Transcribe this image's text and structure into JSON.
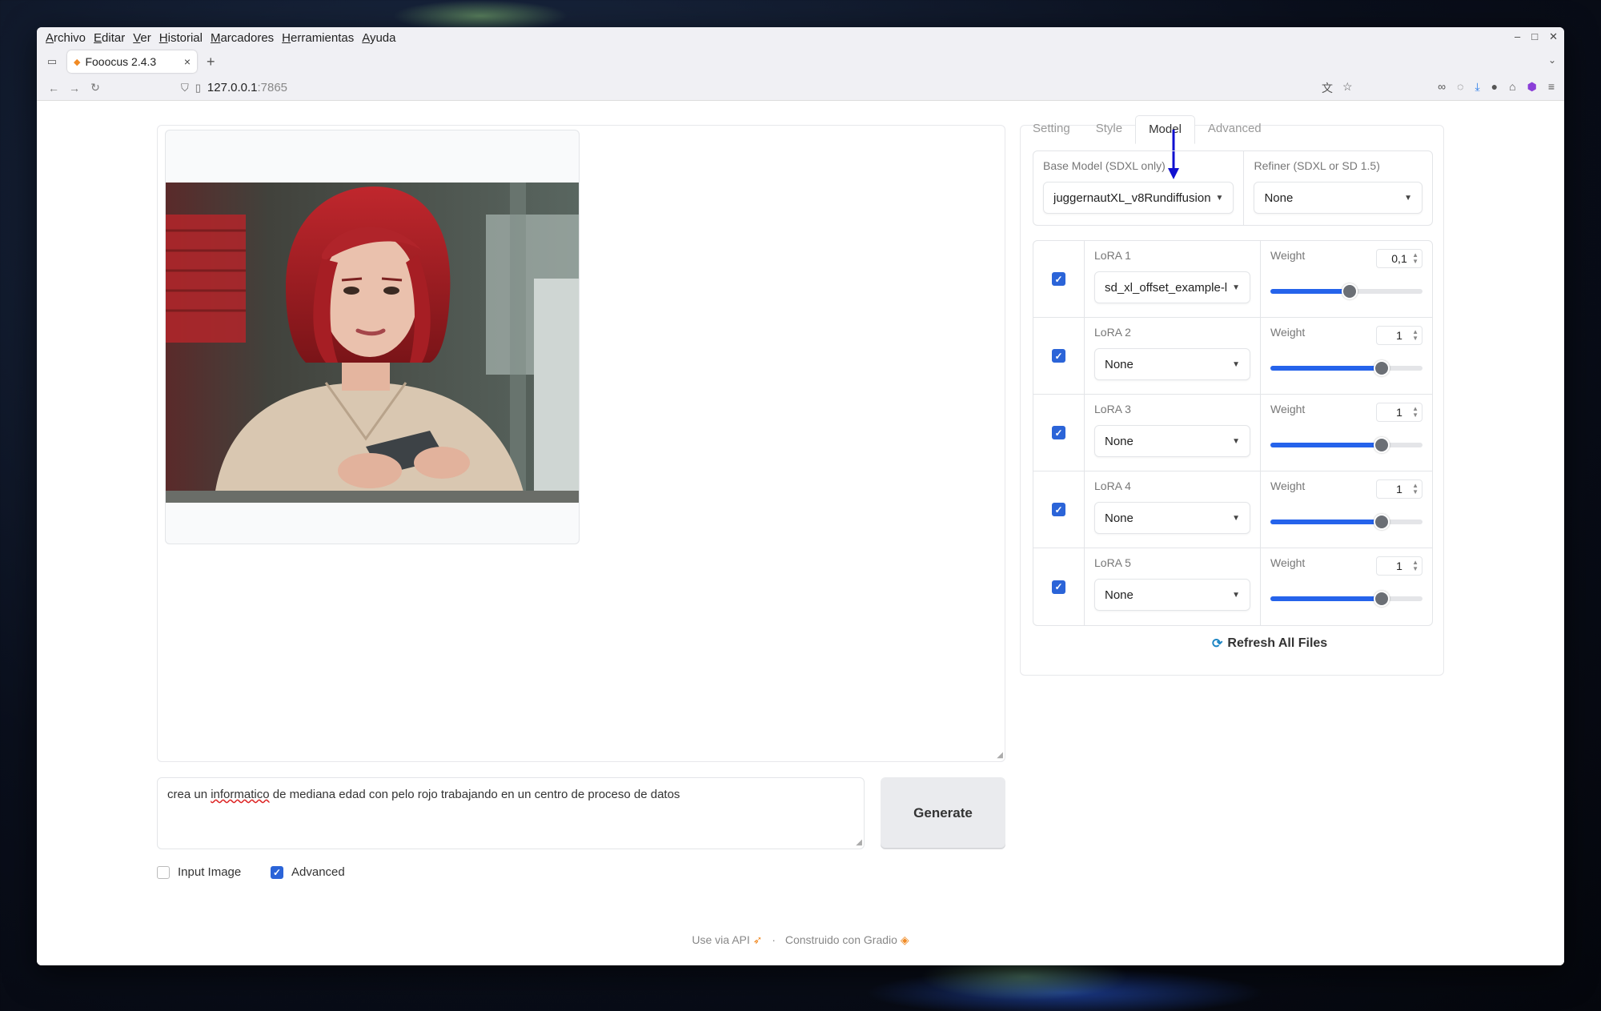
{
  "browser": {
    "menu": [
      "Archivo",
      "Editar",
      "Ver",
      "Historial",
      "Marcadores",
      "Herramientas",
      "Ayuda"
    ],
    "tab_title": "Fooocus 2.4.3",
    "url_host": "127.0.0.1",
    "url_port": ":7865",
    "new_tab_symbol": "+",
    "tab_close_symbol": "×"
  },
  "left": {
    "prompt_before": "crea un ",
    "prompt_spell": "informatico",
    "prompt_after": " de mediana edad con pelo rojo trabajando en un centro de proceso de datos",
    "generate_label": "Generate",
    "input_image_label": "Input Image",
    "advanced_label": "Advanced",
    "input_image_checked": false,
    "advanced_checked": true
  },
  "right": {
    "tabs": [
      "Setting",
      "Style",
      "Model",
      "Advanced"
    ],
    "active_tab": "Model",
    "base_model_label": "Base Model (SDXL only)",
    "base_model_value": "juggernautXL_v8Rundiffusion",
    "refiner_label": "Refiner (SDXL or SD 1.5)",
    "refiner_value": "None",
    "weight_label": "Weight",
    "loras": [
      {
        "label": "LoRA 1",
        "value": "sd_xl_offset_example-lora",
        "weight": "0,1",
        "weight_fraction": 0.52,
        "checked": true
      },
      {
        "label": "LoRA 2",
        "value": "None",
        "weight": "1",
        "weight_fraction": 0.73,
        "checked": true
      },
      {
        "label": "LoRA 3",
        "value": "None",
        "weight": "1",
        "weight_fraction": 0.73,
        "checked": true
      },
      {
        "label": "LoRA 4",
        "value": "None",
        "weight": "1",
        "weight_fraction": 0.73,
        "checked": true
      },
      {
        "label": "LoRA 5",
        "value": "None",
        "weight": "1",
        "weight_fraction": 0.73,
        "checked": true
      }
    ],
    "refresh_label": "Refresh All Files"
  },
  "footer": {
    "api_label": "Use via API",
    "separator": "·",
    "built_label": "Construido con Gradio"
  },
  "colors": {
    "accent": "#2563eb",
    "checkbox": "#2b64d8",
    "annotation_arrow": "#1010d0"
  },
  "icons": [
    "back-icon",
    "forward-icon",
    "reload-icon",
    "shield-icon",
    "page-icon",
    "translate-icon",
    "star-icon",
    "download-icon",
    "menu-icon",
    "rocket-icon",
    "gradio-icon",
    "refresh-icon"
  ]
}
